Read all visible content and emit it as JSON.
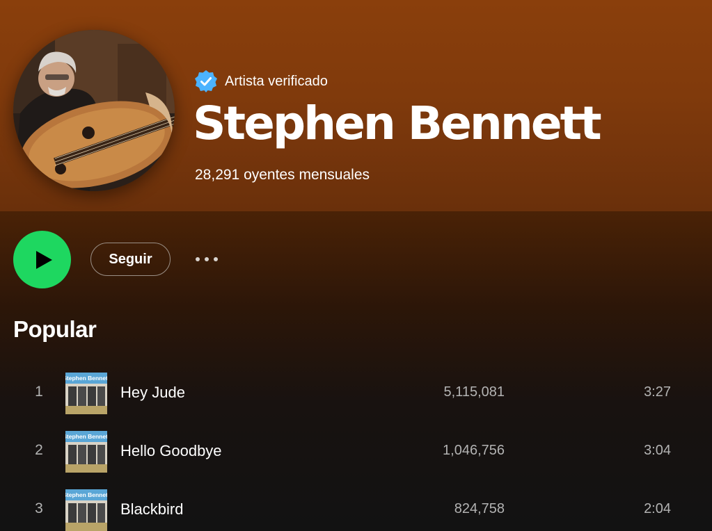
{
  "artist": {
    "verified_label": "Artista verificado",
    "name": "Stephen Bennett",
    "monthly_listeners": "28,291 oyentes mensuales"
  },
  "actions": {
    "follow_label": "Seguir"
  },
  "popular": {
    "title": "Popular",
    "tracks": [
      {
        "number": "1",
        "title": "Hey Jude",
        "plays": "5,115,081",
        "duration": "3:27",
        "art_caption": "Stephen Bennett"
      },
      {
        "number": "2",
        "title": "Hello Goodbye",
        "plays": "1,046,756",
        "duration": "3:04",
        "art_caption": "Stephen Bennett"
      },
      {
        "number": "3",
        "title": "Blackbird",
        "plays": "824,758",
        "duration": "2:04",
        "art_caption": "Stephen Bennett"
      }
    ]
  },
  "colors": {
    "hero": "#8a3f0c",
    "accent_green": "#1ed760",
    "verified_blue": "#4cb3ff",
    "muted_text": "#b3b3b3"
  },
  "icons": [
    "verified-badge-icon",
    "play-icon",
    "more-options-icon"
  ]
}
